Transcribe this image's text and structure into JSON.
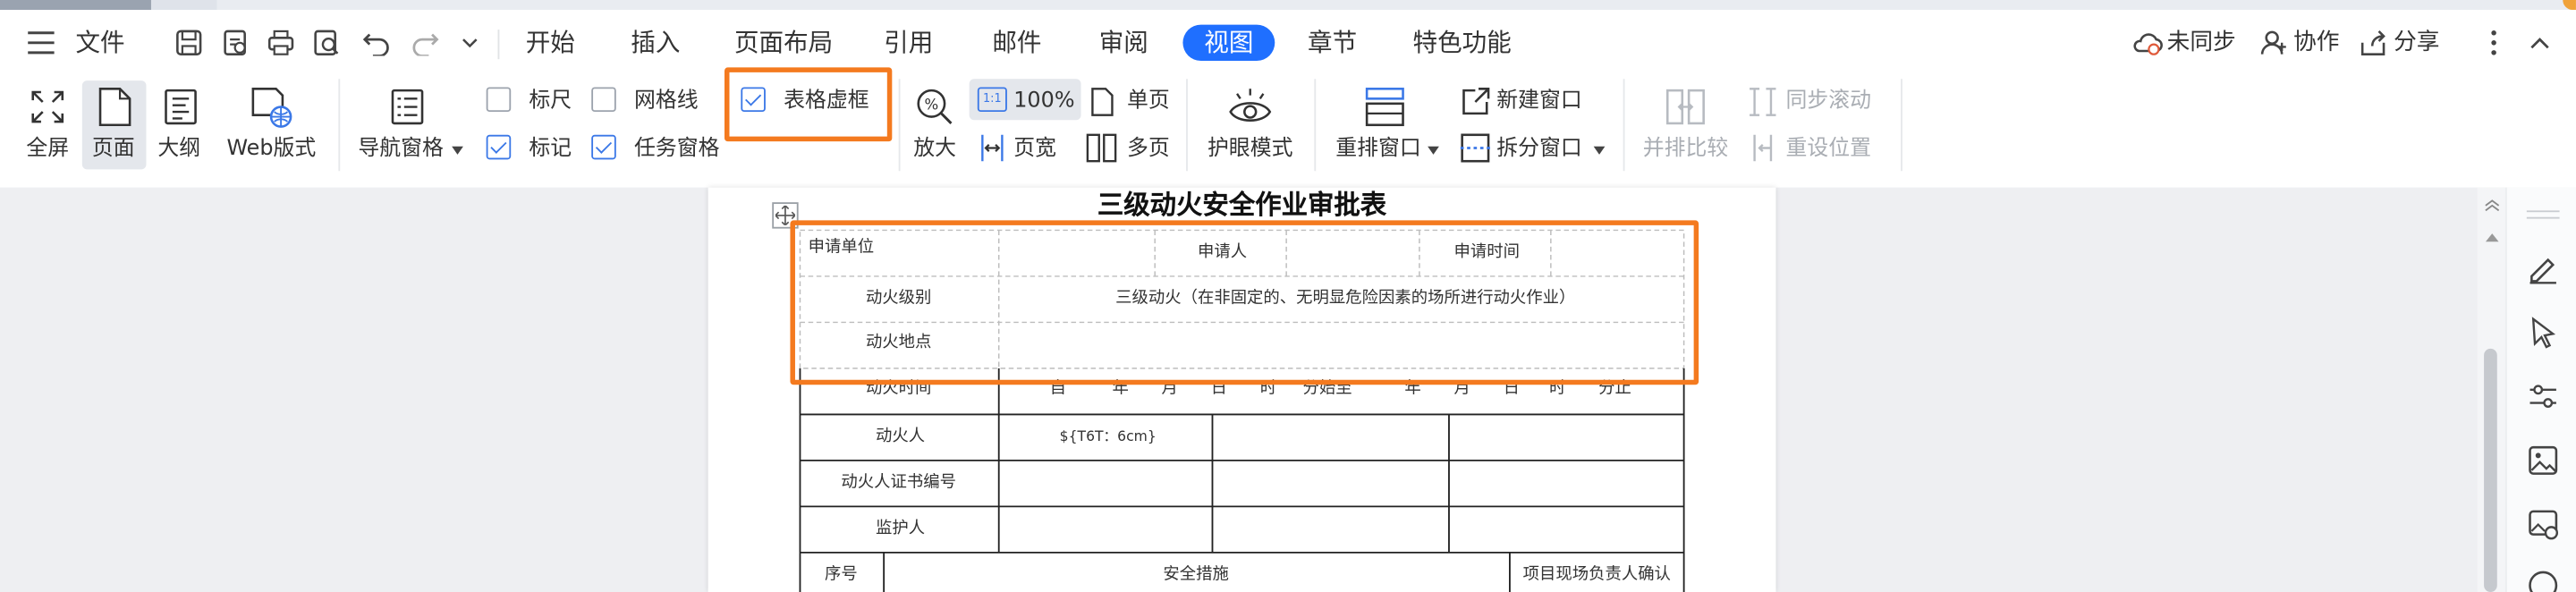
{
  "menu": {
    "file_label": "文件",
    "tabs": [
      "开始",
      "插入",
      "页面布局",
      "引用",
      "邮件",
      "审阅",
      "视图",
      "章节",
      "特色功能"
    ],
    "active_tab": "视图",
    "right": {
      "sync": "未同步",
      "collab": "协作",
      "share": "分享"
    }
  },
  "ribbon": {
    "fullscreen": "全屏",
    "page": "页面",
    "outline": "大纲",
    "web": "Web版式",
    "nav_pane": "导航窗格",
    "ruler": "标尺",
    "gridlines": "网格线",
    "table_frame": "表格虚框",
    "marks": "标记",
    "task_pane": "任务窗格",
    "zoom": "放大",
    "zoom100": "100%",
    "zoom100_icon_text": "1:1",
    "page_width": "页宽",
    "single_page": "单页",
    "multi_page": "多页",
    "eye_mode": "护眼模式",
    "rearrange": "重排窗口",
    "new_window": "新建窗口",
    "split_window": "拆分窗口",
    "side_by_side": "并排比较",
    "sync_scroll": "同步滚动",
    "reset_pos": "重设位置",
    "checkboxes": {
      "ruler": false,
      "gridlines": false,
      "table_frame": true,
      "marks": true,
      "task_pane": true
    }
  },
  "colors": {
    "accent": "#1f6fff",
    "highlight": "#f47a1f",
    "checkbox": "#3b78e7"
  },
  "document": {
    "title": "三级动火安全作业审批表",
    "rows": {
      "r1": {
        "unit": "申请单位",
        "applicant": "申请人",
        "time": "申请时间"
      },
      "r2": {
        "label": "动火级别",
        "value": "三级动火（在非固定的、无明显危险因素的场所进行动火作业）"
      },
      "r3": {
        "label": "动火地点"
      },
      "r4": {
        "label": "动火时间",
        "parts": [
          "自",
          "年",
          "月",
          "日",
          "时",
          "分始至",
          "年",
          "月",
          "日",
          "时",
          "分止"
        ]
      },
      "r5": {
        "label": "动火人",
        "value": "${T6T：6cm}"
      },
      "r6": {
        "label": "动火人证书编号"
      },
      "r7": {
        "label": "监护人"
      },
      "r8": {
        "no": "序号",
        "measures": "安全措施",
        "confirm": "项目现场负责人确认"
      }
    }
  }
}
